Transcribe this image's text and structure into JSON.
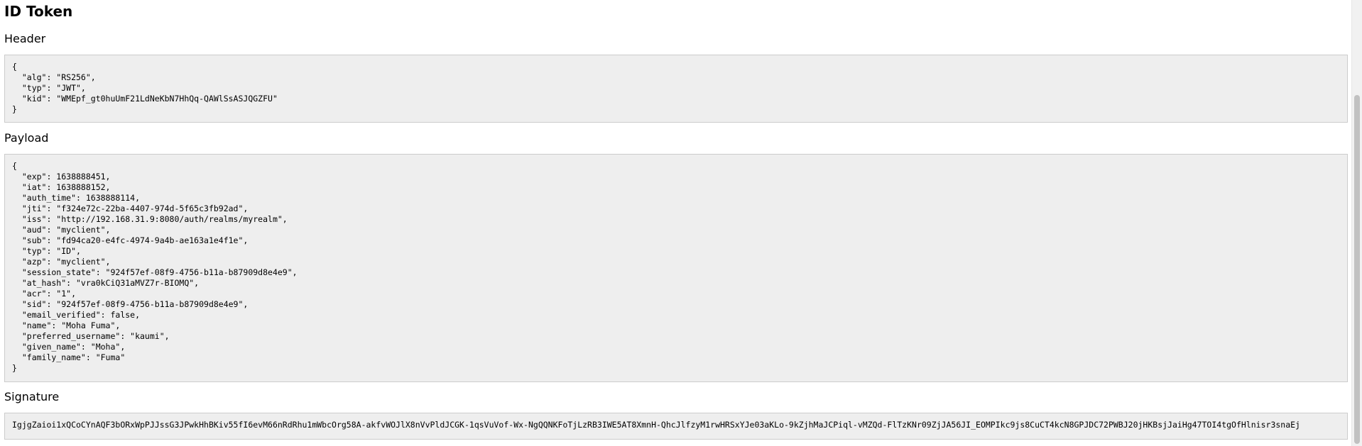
{
  "title": "ID Token",
  "header": {
    "label": "Header",
    "lines": [
      "{",
      "  \"alg\": \"RS256\",",
      "  \"typ\": \"JWT\",",
      "  \"kid\": \"WMEpf_gt0huUmF21LdNeKbN7HhQq-QAWlSsASJQGZFU\"",
      "}"
    ]
  },
  "payload": {
    "label": "Payload",
    "lines": [
      "{",
      "  \"exp\": 1638888451,",
      "  \"iat\": 1638888152,",
      "  \"auth_time\": 1638888114,",
      "  \"jti\": \"f324e72c-22ba-4407-974d-5f65c3fb92ad\",",
      "  \"iss\": \"http://192.168.31.9:8080/auth/realms/myrealm\",",
      "  \"aud\": \"myclient\",",
      "  \"sub\": \"fd94ca20-e4fc-4974-9a4b-ae163a1e4f1e\",",
      "  \"typ\": \"ID\",",
      "  \"azp\": \"myclient\",",
      "  \"session_state\": \"924f57ef-08f9-4756-b11a-b87909d8e4e9\",",
      "  \"at_hash\": \"vra0kCiQ31aMVZ7r-BIOMQ\",",
      "  \"acr\": \"1\",",
      "  \"sid\": \"924f57ef-08f9-4756-b11a-b87909d8e4e9\",",
      "  \"email_verified\": false,",
      "  \"name\": \"Moha Fuma\",",
      "  \"preferred_username\": \"kaumi\",",
      "  \"given_name\": \"Moha\",",
      "  \"family_name\": \"Fuma\"",
      "}"
    ]
  },
  "signature": {
    "label": "Signature",
    "value": "IgjgZaioi1xQCoCYnAQF3bORxWpPJJssG3JPwkHhBKiv55fI6evM66nRdRhu1mWbcOrg58A-akfvWOJlX8nVvPldJCGK-1qsVuVof-Wx-NgQQNKFoTjLzRB3IWE5AT8XmnH-QhcJlfzyM1rwHRSxYJe03aKLo-9kZjhMaJCPiql-vMZQd-FlTzKNr09ZjJA56JI_EOMPIkc9js8CuCT4kcN8GPJDC72PWBJ20jHKBsjJaiHg47TOI4tgOfHlnisr3snaEj"
  }
}
